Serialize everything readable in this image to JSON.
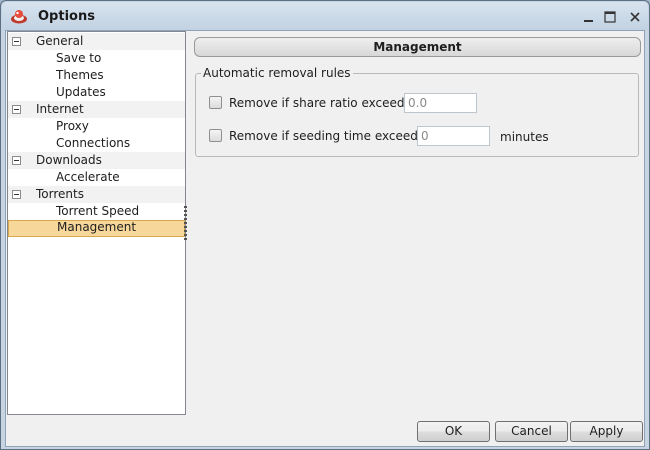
{
  "window": {
    "title": "Options",
    "controls": {
      "minimize_icon": "minimize-icon",
      "maximize_icon": "maximize-icon",
      "close_icon": "close-icon"
    }
  },
  "tree": {
    "categories": [
      {
        "label": "General",
        "expanded": true,
        "children": [
          "Save to",
          "Themes",
          "Updates"
        ]
      },
      {
        "label": "Internet",
        "expanded": true,
        "children": [
          "Proxy",
          "Connections"
        ]
      },
      {
        "label": "Downloads",
        "expanded": true,
        "children": [
          "Accelerate"
        ]
      },
      {
        "label": "Torrents",
        "expanded": true,
        "children": [
          "Torrent Speed",
          "Management"
        ]
      }
    ],
    "selected": "Management"
  },
  "panel": {
    "header": "Management",
    "group_title": "Automatic removal rules",
    "rules": [
      {
        "label": "Remove if share ratio exceedes",
        "checked": false,
        "value": "0.0",
        "unit": ""
      },
      {
        "label": "Remove if seeding time exceedes",
        "checked": false,
        "value": "0",
        "unit": "minutes"
      }
    ]
  },
  "buttons": {
    "ok": "OK",
    "cancel": "Cancel",
    "apply": "Apply"
  },
  "colors": {
    "selection": "#f7d89a",
    "selection_border": "#d6a94a",
    "window_frame": "#c7d5e3",
    "client_bg": "#f0f0f0"
  }
}
